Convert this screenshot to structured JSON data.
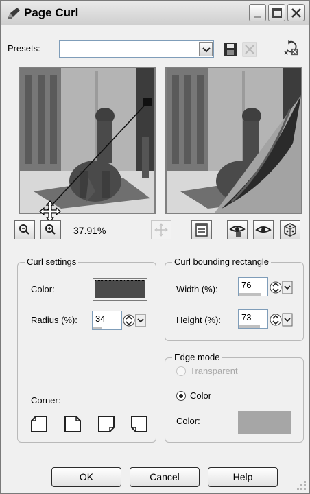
{
  "window": {
    "title": "Page Curl"
  },
  "presets": {
    "label": "Presets:",
    "value": ""
  },
  "zoom": {
    "level": "37.91%"
  },
  "curl_settings": {
    "title": "Curl settings",
    "color_label": "Color:",
    "color_value": "#4a4a4a",
    "radius_label": "Radius (%):",
    "radius_value": "34",
    "corner_label": "Corner:"
  },
  "bounding_rect": {
    "title": "Curl bounding rectangle",
    "width_label": "Width (%):",
    "width_value": "76",
    "height_label": "Height (%):",
    "height_value": "73"
  },
  "edge_mode": {
    "title": "Edge mode",
    "transparent_label": "Transparent",
    "color_option_label": "Color",
    "color_label": "Color:",
    "color_value": "#a6a6a6"
  },
  "buttons": {
    "ok": "OK",
    "cancel": "Cancel",
    "help": "Help"
  }
}
